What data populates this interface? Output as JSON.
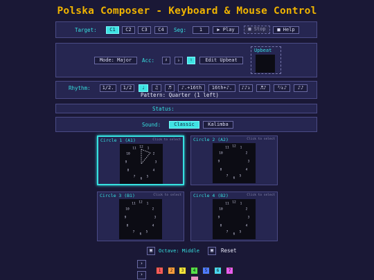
{
  "title": "Polska Composer - Keyboard & Mouse Control",
  "target": {
    "label": "Target:",
    "options": [
      "C1",
      "C2",
      "C3",
      "C4"
    ],
    "seg_label": "Seg:",
    "seg_value": "1",
    "play": "▶ Play",
    "stop": "■ Stop",
    "help": "■ Help"
  },
  "mode": {
    "mode_button": "Mode: Major",
    "acc_label": "Acc:",
    "acc_options": [
      "♯",
      "♭",
      "♮"
    ],
    "edit_upbeat": "Edit Upbeat",
    "upbeat_title": "Upbeat"
  },
  "rhythm": {
    "label": "Rhythm:",
    "options": [
      "1/2.",
      "1/2",
      "♩",
      "♫",
      "♬",
      "♪.+16th",
      "16th+♪.",
      "♪♪₃",
      "♬♪",
      "³⁄₄♪",
      "♪♪"
    ],
    "pattern": "Pattern: Quarter (1 left)"
  },
  "status": {
    "label": "Status:"
  },
  "sound": {
    "label": "Sound:",
    "options": [
      "Classic",
      "Kalimba"
    ]
  },
  "circles": [
    {
      "title": "Circle 1 (A1)",
      "hint": "Click to select"
    },
    {
      "title": "Circle 2 (A2)",
      "hint": "Click to select"
    },
    {
      "title": "Circle 3 (B1)",
      "hint": "Click to select"
    },
    {
      "title": "Circle 4 (B2)",
      "hint": "Click to select"
    }
  ],
  "dial_numbers": [
    "12",
    "1",
    "2",
    "3",
    "4",
    "5",
    "6",
    "7",
    "8",
    "9",
    "10",
    "11"
  ],
  "octave": {
    "label": "Octave: Middle",
    "reset": "Reset"
  },
  "notes": [
    "1",
    "2",
    "3",
    "4",
    "5",
    "6",
    "7"
  ],
  "colors": {
    "accent": "#36e0e0",
    "title": "#f0b400",
    "background": "#1a1836",
    "panel": "#262651"
  }
}
